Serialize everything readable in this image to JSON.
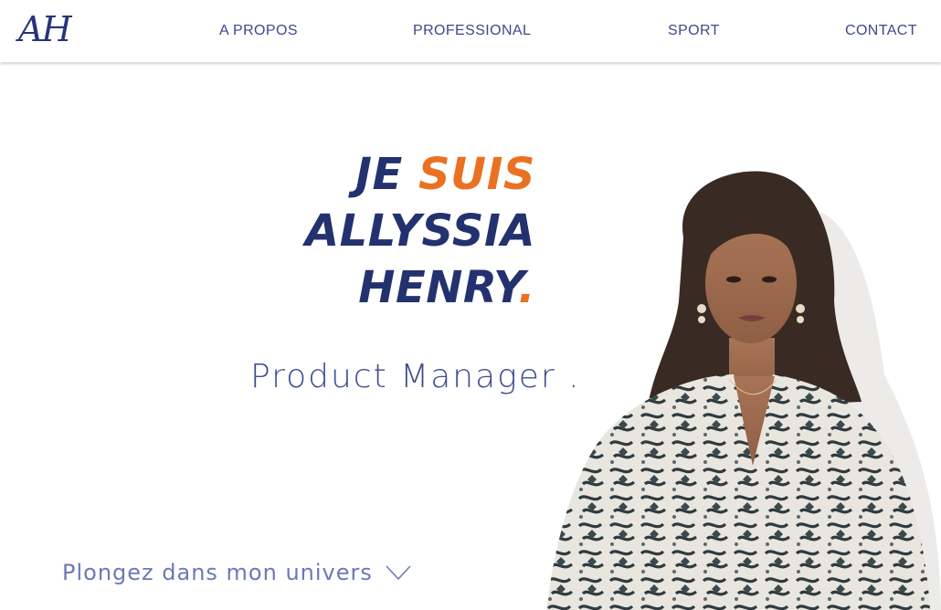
{
  "logo": "AH",
  "nav": [
    "A PROPOS",
    "PROFESSIONAL",
    "SPORT",
    "CONTACT"
  ],
  "hero": {
    "je": "JE",
    "suis": "SUIS",
    "first_name": "ALLYSSIA",
    "last_name": "HENRY",
    "dot": "."
  },
  "subtitle": "Product Manager .",
  "scroll_prompt": "Plongez dans mon univers",
  "colors": {
    "navy": "#23326f",
    "orange": "#ea7122",
    "nav_text": "#3c4a8a",
    "light_text": "#6c79b5"
  },
  "icons": {
    "scroll": "chevron-down-icon"
  }
}
